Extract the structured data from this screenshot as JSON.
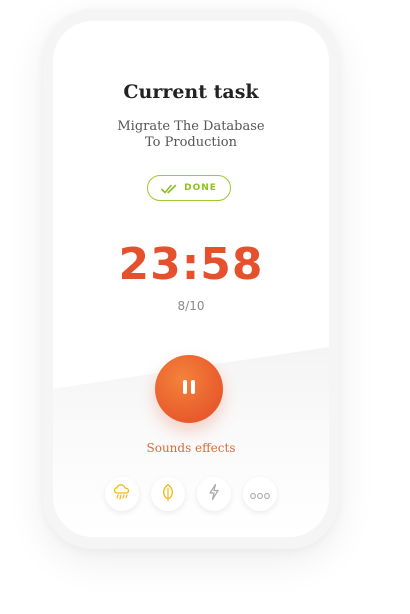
{
  "task": {
    "heading": "Current task",
    "name_line1": "Migrate The Database",
    "name_line2": "To Production"
  },
  "done_button": {
    "label": "DONE"
  },
  "timer": {
    "time": "23:58",
    "progress": "8/10"
  },
  "sounds": {
    "label": "Sounds effects",
    "items": [
      {
        "icon": "rain-cloud-icon",
        "color": "#f2b81a"
      },
      {
        "icon": "leaf-icon",
        "color": "#f2b81a"
      },
      {
        "icon": "lightning-icon",
        "color": "#aaaaaa"
      },
      {
        "icon": "more-icon",
        "color": "#aaaaaa"
      }
    ]
  },
  "colors": {
    "accent": "#e6512d",
    "success": "#8fbf24",
    "highlight": "#f2b81a"
  }
}
